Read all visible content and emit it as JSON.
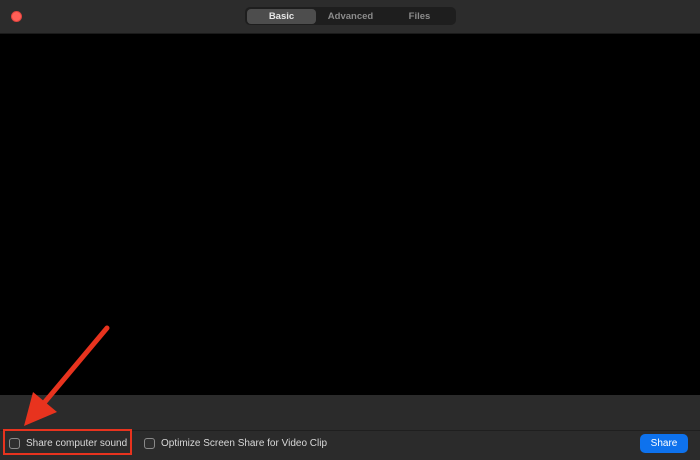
{
  "window": {
    "tabs": [
      {
        "label": "Basic",
        "active": true
      },
      {
        "label": "Advanced",
        "active": false
      },
      {
        "label": "Files",
        "active": false
      }
    ]
  },
  "options": {
    "share_sound": {
      "label": "Share computer sound",
      "checked": false
    },
    "optimize_video": {
      "label": "Optimize Screen Share for Video Clip",
      "checked": false
    }
  },
  "actions": {
    "share_label": "Share"
  },
  "annotation": {
    "color": "#e8331e",
    "type": "arrow-and-box"
  },
  "colors": {
    "close": "#fe5f57",
    "accent": "#0e72ed",
    "background": "#2b2b2b"
  }
}
